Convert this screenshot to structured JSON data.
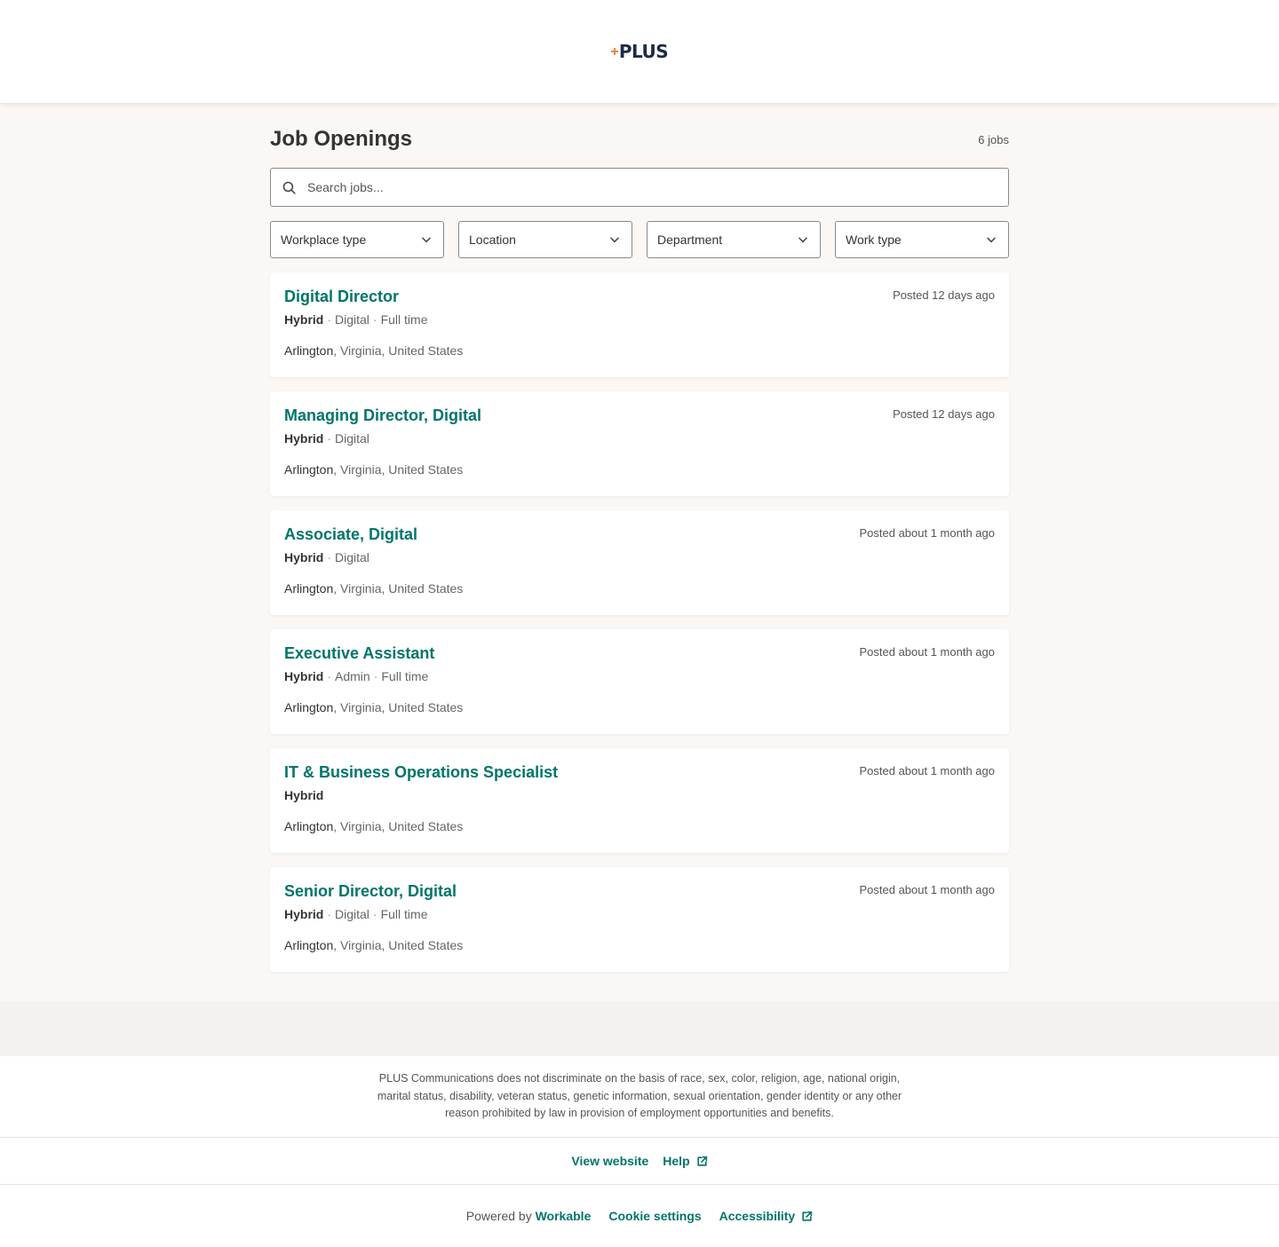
{
  "brand": {
    "logo_text": "PLUS",
    "accent": "#00756a",
    "logo_mark_color": "#e6873a"
  },
  "page": {
    "title": "Job Openings",
    "job_count": "6 jobs"
  },
  "search": {
    "placeholder": "Search jobs..."
  },
  "filters": [
    "Workplace type",
    "Location",
    "Department",
    "Work type"
  ],
  "jobs": [
    {
      "title": "Digital Director",
      "workplace": "Hybrid",
      "department": "Digital",
      "type": "Full time",
      "location_city": "Arlington",
      "location_rest": ", Virginia, United States",
      "posted": "Posted 12 days ago"
    },
    {
      "title": "Managing Director, Digital",
      "workplace": "Hybrid",
      "department": "Digital",
      "type": "",
      "location_city": "Arlington",
      "location_rest": ", Virginia, United States",
      "posted": "Posted 12 days ago"
    },
    {
      "title": "Associate, Digital",
      "workplace": "Hybrid",
      "department": "Digital",
      "type": "",
      "location_city": "Arlington",
      "location_rest": ", Virginia, United States",
      "posted": "Posted about 1 month ago"
    },
    {
      "title": "Executive Assistant",
      "workplace": "Hybrid",
      "department": "Admin",
      "type": "Full time",
      "location_city": "Arlington",
      "location_rest": ", Virginia, United States",
      "posted": "Posted about 1 month ago"
    },
    {
      "title": "IT & Business Operations Specialist",
      "workplace": "Hybrid",
      "department": "",
      "type": "",
      "location_city": "Arlington",
      "location_rest": ", Virginia, United States",
      "posted": "Posted about 1 month ago"
    },
    {
      "title": "Senior Director, Digital",
      "workplace": "Hybrid",
      "department": "Digital",
      "type": "Full time",
      "location_city": "Arlington",
      "location_rest": ", Virginia, United States",
      "posted": "Posted about 1 month ago"
    }
  ],
  "footer": {
    "notice": "PLUS Communications does not discriminate on the basis of race, sex, color, religion, age, national origin, marital status, disability, veteran status, genetic information, sexual orientation, gender identity or any other reason prohibited by law in provision of employment opportunities and benefits.",
    "view_website": "View website",
    "help": "Help",
    "powered_by": "Powered by",
    "workable": "Workable",
    "cookie_settings": "Cookie settings",
    "accessibility": "Accessibility"
  }
}
